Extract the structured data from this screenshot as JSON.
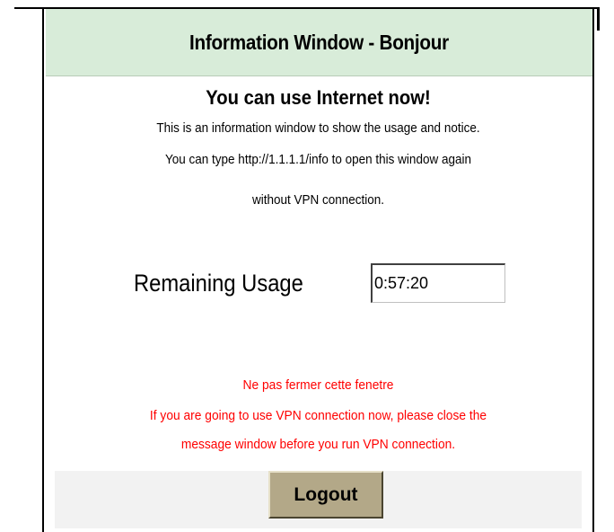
{
  "window": {
    "title": "Information Window - Bonjour"
  },
  "content": {
    "headline": "You can use Internet now!",
    "info_lines": [
      "This is an information window to show the usage and notice.",
      "You can type http://1.1.1.1/info to open this window again",
      "without VPN connection."
    ]
  },
  "usage": {
    "label": "Remaining Usage",
    "value": "0:57:20"
  },
  "notice": {
    "lines": [
      "Ne pas fermer cette fenetre",
      "If you are going to use VPN connection now, please close the",
      "message window before you run VPN connection."
    ],
    "color": "#ff0000"
  },
  "footer": {
    "logout_label": "Logout"
  },
  "colors": {
    "header_bg": "#d8ecd9",
    "button_bg": "#b3a888",
    "footer_bg": "#f2f2f2"
  }
}
